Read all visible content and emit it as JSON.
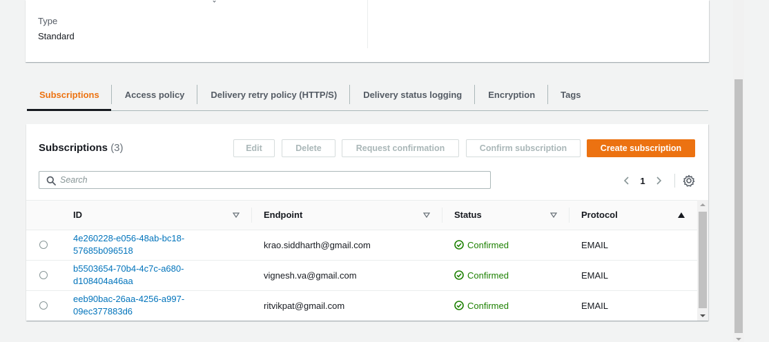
{
  "details": {
    "type_label": "Type",
    "type_value": "Standard"
  },
  "tabs": [
    {
      "label": "Subscriptions",
      "active": true
    },
    {
      "label": "Access policy",
      "active": false
    },
    {
      "label": "Delivery retry policy (HTTP/S)",
      "active": false
    },
    {
      "label": "Delivery status logging",
      "active": false
    },
    {
      "label": "Encryption",
      "active": false
    },
    {
      "label": "Tags",
      "active": false
    }
  ],
  "panel": {
    "title": "Subscriptions",
    "count": "(3)",
    "buttons": {
      "edit": "Edit",
      "delete": "Delete",
      "request_confirmation": "Request confirmation",
      "confirm_subscription": "Confirm subscription",
      "create_subscription": "Create subscription"
    },
    "search": {
      "placeholder": "Search",
      "value": ""
    },
    "pager": {
      "current_page": "1"
    },
    "table": {
      "columns": [
        "ID",
        "Endpoint",
        "Status",
        "Protocol"
      ],
      "rows": [
        {
          "id_line1": "4e260228-e056-48ab-bc18-",
          "id_line2": "57685b096518",
          "endpoint": "krao.siddharth@gmail.com",
          "status": "Confirmed",
          "protocol": "EMAIL"
        },
        {
          "id_line1": "b5503654-70b4-4c7c-a680-",
          "id_line2": "d108404a46aa",
          "endpoint": "vignesh.va@gmail.com",
          "status": "Confirmed",
          "protocol": "EMAIL"
        },
        {
          "id_line1": "eeb90bac-26aa-4256-a997-",
          "id_line2": "09ec377883d6",
          "endpoint": "ritvikpat@gmail.com",
          "status": "Confirmed",
          "protocol": "EMAIL"
        }
      ]
    }
  },
  "colors": {
    "accent": "#ec7211",
    "link": "#0073bb",
    "success": "#1d8102",
    "disabled_text": "#aab7b8"
  },
  "icons": [
    "search-icon",
    "chevron-left-icon",
    "chevron-right-icon",
    "settings-icon",
    "sort-down-icon",
    "sort-up-icon",
    "check-circle-icon"
  ]
}
